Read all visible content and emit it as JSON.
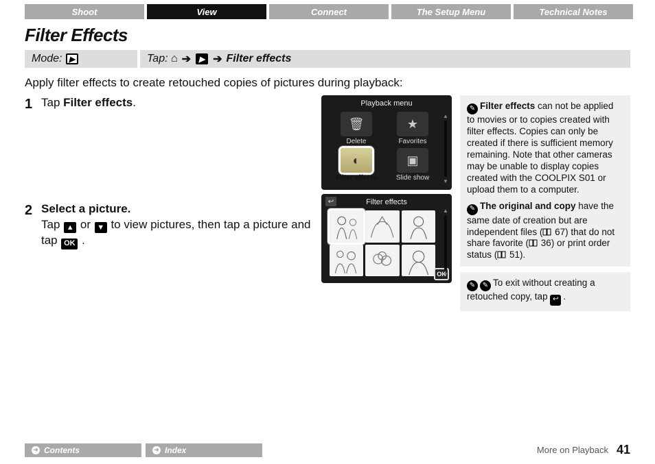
{
  "tabs": [
    "Shoot",
    "View",
    "Connect",
    "The Setup Menu",
    "Technical Notes"
  ],
  "active_tab_index": 1,
  "title": "Filter Effects",
  "mode_label": "Mode:",
  "tap_label": "Tap:",
  "tap_target": "Filter effects",
  "arrow": "➔",
  "intro": "Apply filter effects to create retouched copies of pictures during playback:",
  "steps": [
    {
      "num": "1",
      "head_prefix": "Tap ",
      "head_bold": "Filter effects",
      "head_suffix": ".",
      "body": ""
    },
    {
      "num": "2",
      "head_prefix": "",
      "head_bold": "Select a picture.",
      "head_suffix": "",
      "body_a": "Tap ",
      "body_b": " or ",
      "body_c": " to view pictures, then tap a picture and tap ",
      "body_d": "."
    }
  ],
  "glyph_up": "▲",
  "glyph_down": "▼",
  "glyph_ok": "OK",
  "glyph_play": "▶",
  "glyph_home": "⌂",
  "screenA": {
    "title": "Playback menu",
    "items": [
      {
        "icon": "🗑",
        "label": "Delete"
      },
      {
        "icon": "★",
        "label": "Favorites"
      },
      {
        "icon": "◐",
        "label": "Filter effects"
      },
      {
        "icon": "▣",
        "label": "Slide show"
      }
    ],
    "selected": 2
  },
  "screenB": {
    "title": "Filter effects",
    "ok": "OK",
    "back": "↩"
  },
  "notes": [
    {
      "parts": [
        {
          "t": "bold",
          "v": "Filter effects"
        },
        {
          "t": "text",
          "v": " can not be applied to movies or to copies created with filter effects. Copies can only be created if there is sufficient memory remaining. Note that other cameras may be unable to display copies created with the COOLPIX S01 or upload them to a computer."
        },
        {
          "t": "br"
        },
        {
          "t": "pencil"
        },
        {
          "t": "bold",
          "v": "The original and copy"
        },
        {
          "t": "text",
          "v": " have the same date of creation but are independent files ("
        },
        {
          "t": "book"
        },
        {
          "t": "text",
          "v": " 67) that do not share favorite ("
        },
        {
          "t": "book"
        },
        {
          "t": "text",
          "v": " 36) or print order status ("
        },
        {
          "t": "book"
        },
        {
          "t": "text",
          "v": " 51)."
        }
      ]
    },
    {
      "parts": [
        {
          "t": "pencil"
        },
        {
          "t": "text",
          "v": "To exit without creating a retouched copy, tap "
        },
        {
          "t": "backglyph"
        },
        {
          "t": "text",
          "v": "."
        }
      ]
    }
  ],
  "footer": {
    "contents": "Contents",
    "index": "Index",
    "chapter": "More on Playback",
    "page": "41"
  }
}
